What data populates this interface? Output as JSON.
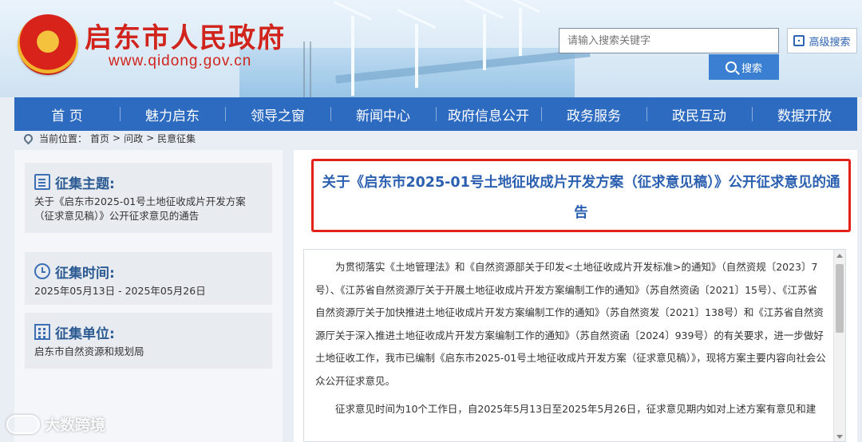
{
  "header": {
    "site_title": "启东市人民政府",
    "site_url": "www.qidong.gov.cn",
    "search_placeholder": "请输入搜索关键字",
    "search_button": "搜索",
    "advanced_search": "高级搜索"
  },
  "nav": {
    "items": [
      "首 页",
      "魅力启东",
      "领导之窗",
      "新闻中心",
      "政府信息公开",
      "政务服务",
      "政民互动",
      "数据开放"
    ]
  },
  "breadcrumb": {
    "label": "当前位置：",
    "path": [
      "首页",
      "问政",
      "民意征集"
    ],
    "separator": ">"
  },
  "sidebar": {
    "topic": {
      "title": "征集主题:",
      "value": "关于《启东市2025-01号土地征收成片开发方案（征求意见稿）》公开征求意见的通告"
    },
    "time": {
      "title": "征集时间:",
      "value": "2025年05月13日 - 2025年05月26日"
    },
    "unit": {
      "title": "征集单位:",
      "value": "启东市自然资源和规划局"
    }
  },
  "main": {
    "title": "关于《启东市2025-01号土地征收成片开发方案（征求意见稿）》公开征求意见的通告",
    "paragraphs": [
      "为贯彻落实《土地管理法》和《自然资源部关于印发<土地征收成片开发标准>的通知》（自然资规〔2023〕7号）、《江苏省自然资源厅关于开展土地征收成片开发方案编制工作的通知》（苏自然资函〔2021〕15号）、《江苏省自然资源厅关于加快推进土地征收成片开发方案编制工作的通知》（苏自然资发〔2021〕138号）和《江苏省自然资源厅关于深入推进土地征收成片开发方案编制工作的通知》（苏自然资函〔2024〕939号）的有关要求，进一步做好土地征收工作，我市已编制《启东市2025-01号土地征收成片开发方案（征求意见稿）》，现将方案主要内容向社会公众公开征求意见。",
      "征求意见时间为10个工作日，自2025年5月13日至2025年5月26日，征求意见期内如对上述方案有意见和建"
    ]
  },
  "watermark": {
    "text": "大数跨境"
  },
  "colors": {
    "nav_blue": "#2d6bc0",
    "title_red": "#d0241c",
    "highlight_border": "#e22218",
    "heading_blue": "#2b5fb0"
  }
}
